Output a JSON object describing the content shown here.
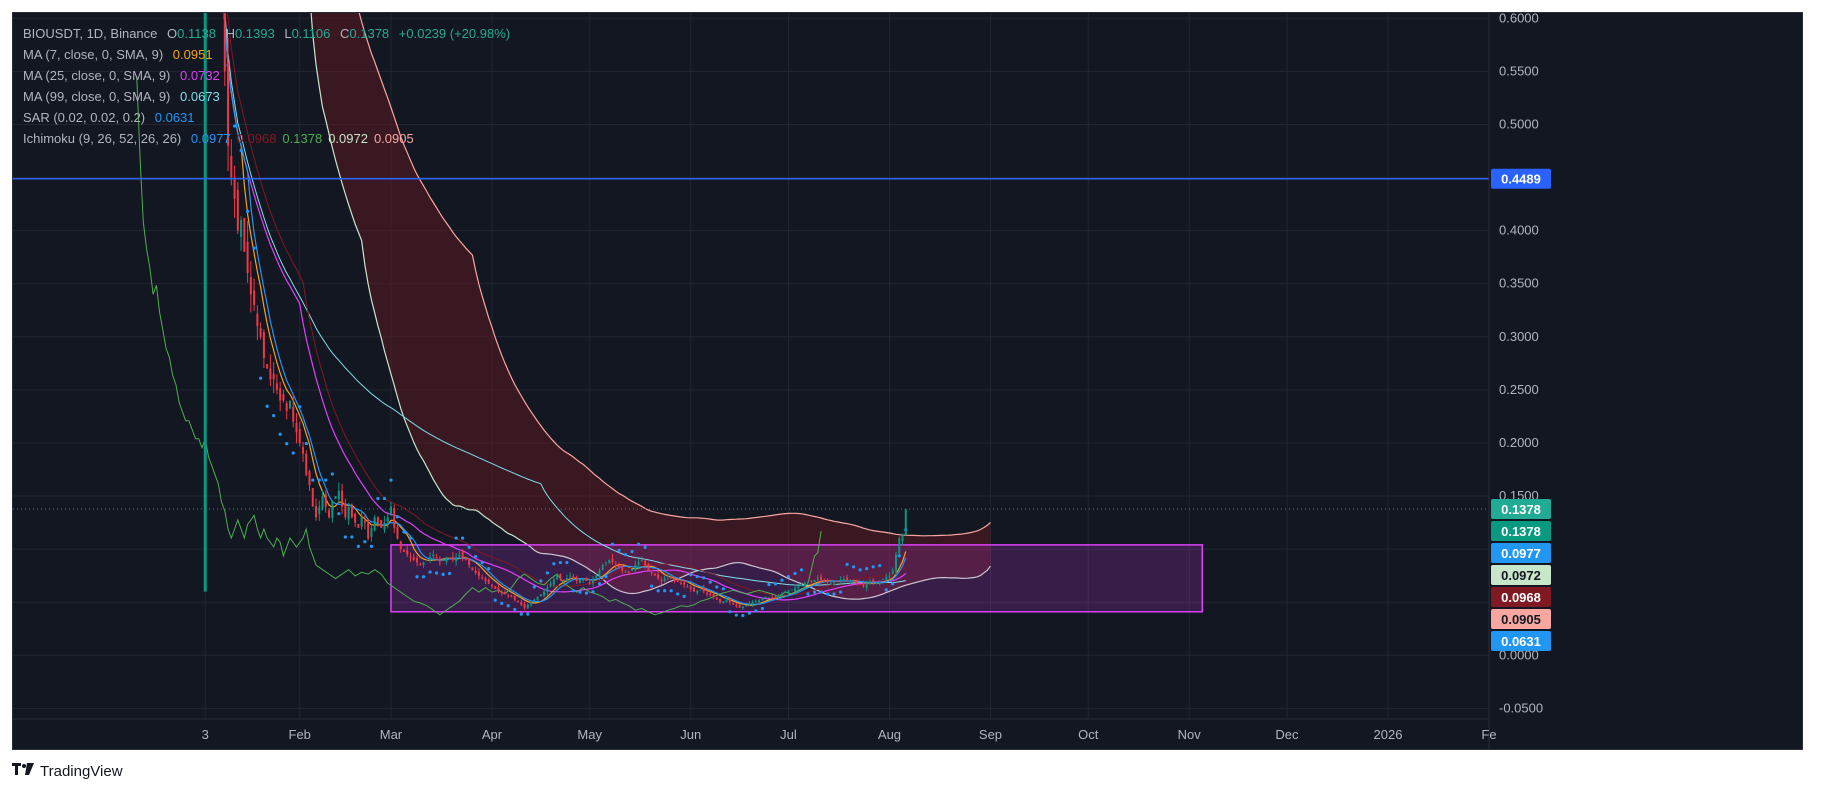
{
  "legend": {
    "symbol": "BIOUSDT, 1D, Binance",
    "ohlc": {
      "o_label": "O",
      "o": "0.1138",
      "h_label": "H",
      "h": "0.1393",
      "l_label": "L",
      "l": "0.1106",
      "c_label": "C",
      "c": "0.1378",
      "change": "+0.0239 (+20.98%)"
    },
    "indicators": [
      {
        "label": "MA (7, close, 0, SMA, 9)",
        "values": [
          "0.0951"
        ],
        "colors": [
          "#f7a21b"
        ]
      },
      {
        "label": "MA (25, close, 0, SMA, 9)",
        "values": [
          "0.0732"
        ],
        "colors": [
          "#e040fb"
        ]
      },
      {
        "label": "MA (99, close, 0, SMA, 9)",
        "values": [
          "0.0673"
        ],
        "colors": [
          "#80deea"
        ]
      },
      {
        "label": "SAR (0.02, 0.02, 0.2)",
        "values": [
          "0.0631"
        ],
        "colors": [
          "#2196f3"
        ]
      },
      {
        "label": "Ichimoku (9, 26, 52, 26, 26)",
        "values": [
          "0.0977",
          "0.0968",
          "0.1378",
          "0.0972",
          "0.0905"
        ],
        "colors": [
          "#2196f3",
          "#801922",
          "#4caf50",
          "#c8e6c9",
          "#f8a7a0"
        ]
      }
    ]
  },
  "watermark": "TradingView",
  "chart_data": {
    "type": "candlestick",
    "symbol": "BIOUSDT",
    "interval": "1D",
    "exchange": "Binance",
    "y_ticks": [
      "0.6000",
      "0.5500",
      "0.5000",
      "0.4500",
      "0.4000",
      "0.3500",
      "0.3000",
      "0.2500",
      "0.2000",
      "0.1500",
      "0.1000",
      "0.0500",
      "0.0000",
      "-0.0500"
    ],
    "ylim": [
      -0.06,
      0.605
    ],
    "x_ticks": [
      {
        "label": "3",
        "day": 0
      },
      {
        "label": "Feb",
        "day": 29
      },
      {
        "label": "Mar",
        "day": 57
      },
      {
        "label": "Apr",
        "day": 88
      },
      {
        "label": "May",
        "day": 118
      },
      {
        "label": "Jun",
        "day": 149
      },
      {
        "label": "Jul",
        "day": 179
      },
      {
        "label": "Aug",
        "day": 210
      },
      {
        "label": "Sep",
        "day": 241
      },
      {
        "label": "Oct",
        "day": 271
      },
      {
        "label": "Nov",
        "day": 302
      },
      {
        "label": "Dec",
        "day": 332
      },
      {
        "label": "2026",
        "day": 363
      },
      {
        "label": "Fe",
        "day": 394
      }
    ],
    "xlim": [
      -59,
      394
    ],
    "horizontal_line": {
      "value": 0.4489,
      "label": "0.4489",
      "color": "#2962ff"
    },
    "current_price": {
      "value": 0.1378,
      "label": "0.1378"
    },
    "price_badges": [
      {
        "label": "0.1378",
        "value": 0.1378,
        "color": "#22ab94"
      },
      {
        "label": "0.1378",
        "value": 0.1378,
        "color": "#089981"
      },
      {
        "label": "0.0977",
        "value": 0.0977,
        "color": "#2196f3"
      },
      {
        "label": "0.0972",
        "value": 0.0972,
        "color": "#c8e6c9"
      },
      {
        "label": "0.0968",
        "value": 0.0968,
        "color": "#801922"
      },
      {
        "label": "0.0905",
        "value": 0.0905,
        "color": "#f8a7a0"
      },
      {
        "label": "0.0631",
        "value": 0.0631,
        "color": "#2196f3"
      }
    ],
    "range_box": {
      "day_start": 57,
      "day_end": 306,
      "low": 0.041,
      "high": 0.104,
      "color": "#e040fb"
    },
    "price_path": [
      [
        5,
        0.64
      ],
      [
        6,
        0.55
      ],
      [
        7,
        0.48
      ],
      [
        8,
        0.45
      ],
      [
        9,
        0.43
      ],
      [
        10,
        0.4
      ],
      [
        11,
        0.41
      ],
      [
        12,
        0.38
      ],
      [
        13,
        0.36
      ],
      [
        14,
        0.34
      ],
      [
        15,
        0.33
      ],
      [
        16,
        0.31
      ],
      [
        17,
        0.3
      ],
      [
        18,
        0.28
      ],
      [
        19,
        0.27
      ],
      [
        20,
        0.26
      ],
      [
        21,
        0.26
      ],
      [
        22,
        0.25
      ],
      [
        23,
        0.24
      ],
      [
        24,
        0.24
      ],
      [
        25,
        0.23
      ],
      [
        26,
        0.24
      ],
      [
        27,
        0.22
      ],
      [
        28,
        0.21
      ],
      [
        29,
        0.2
      ],
      [
        30,
        0.19
      ],
      [
        31,
        0.17
      ],
      [
        32,
        0.16
      ],
      [
        33,
        0.14
      ],
      [
        34,
        0.13
      ],
      [
        35,
        0.14
      ],
      [
        36,
        0.15
      ],
      [
        37,
        0.14
      ],
      [
        38,
        0.13
      ],
      [
        39,
        0.145
      ],
      [
        40,
        0.15
      ],
      [
        41,
        0.155
      ],
      [
        42,
        0.14
      ],
      [
        43,
        0.13
      ],
      [
        44,
        0.14
      ],
      [
        45,
        0.13
      ],
      [
        46,
        0.125
      ],
      [
        47,
        0.12
      ],
      [
        48,
        0.13
      ],
      [
        49,
        0.125
      ],
      [
        50,
        0.11
      ],
      [
        51,
        0.12
      ],
      [
        52,
        0.13
      ],
      [
        53,
        0.125
      ],
      [
        54,
        0.12
      ],
      [
        55,
        0.125
      ],
      [
        56,
        0.13
      ],
      [
        57,
        0.14
      ],
      [
        58,
        0.12
      ],
      [
        60,
        0.1
      ],
      [
        62,
        0.095
      ],
      [
        64,
        0.09
      ],
      [
        66,
        0.085
      ],
      [
        68,
        0.09
      ],
      [
        70,
        0.095
      ],
      [
        72,
        0.088
      ],
      [
        74,
        0.092
      ],
      [
        76,
        0.09
      ],
      [
        78,
        0.095
      ],
      [
        80,
        0.09
      ],
      [
        82,
        0.08
      ],
      [
        84,
        0.075
      ],
      [
        86,
        0.07
      ],
      [
        88,
        0.065
      ],
      [
        90,
        0.06
      ],
      [
        92,
        0.058
      ],
      [
        94,
        0.055
      ],
      [
        96,
        0.05
      ],
      [
        98,
        0.045
      ],
      [
        100,
        0.05
      ],
      [
        102,
        0.055
      ],
      [
        104,
        0.06
      ],
      [
        106,
        0.068
      ],
      [
        108,
        0.075
      ],
      [
        110,
        0.07
      ],
      [
        112,
        0.075
      ],
      [
        114,
        0.07
      ],
      [
        116,
        0.072
      ],
      [
        118,
        0.068
      ],
      [
        120,
        0.075
      ],
      [
        122,
        0.085
      ],
      [
        124,
        0.09
      ],
      [
        126,
        0.085
      ],
      [
        128,
        0.08
      ],
      [
        130,
        0.078
      ],
      [
        132,
        0.085
      ],
      [
        134,
        0.09
      ],
      [
        136,
        0.08
      ],
      [
        138,
        0.075
      ],
      [
        140,
        0.07
      ],
      [
        142,
        0.075
      ],
      [
        144,
        0.07
      ],
      [
        146,
        0.068
      ],
      [
        148,
        0.065
      ],
      [
        150,
        0.06
      ],
      [
        152,
        0.062
      ],
      [
        154,
        0.058
      ],
      [
        156,
        0.055
      ],
      [
        158,
        0.05
      ],
      [
        160,
        0.052
      ],
      [
        162,
        0.048
      ],
      [
        164,
        0.045
      ],
      [
        166,
        0.047
      ],
      [
        168,
        0.05
      ],
      [
        170,
        0.052
      ],
      [
        172,
        0.055
      ],
      [
        174,
        0.054
      ],
      [
        176,
        0.056
      ],
      [
        178,
        0.06
      ],
      [
        180,
        0.062
      ],
      [
        182,
        0.065
      ],
      [
        184,
        0.068
      ],
      [
        186,
        0.07
      ],
      [
        188,
        0.072
      ],
      [
        190,
        0.07
      ],
      [
        192,
        0.068
      ],
      [
        194,
        0.07
      ],
      [
        196,
        0.072
      ],
      [
        198,
        0.07
      ],
      [
        200,
        0.068
      ],
      [
        202,
        0.065
      ],
      [
        204,
        0.07
      ],
      [
        206,
        0.068
      ],
      [
        208,
        0.072
      ],
      [
        210,
        0.075
      ],
      [
        211,
        0.08
      ],
      [
        212,
        0.095
      ],
      [
        213,
        0.11
      ],
      [
        214,
        0.1138
      ],
      [
        215,
        0.1378
      ]
    ]
  }
}
